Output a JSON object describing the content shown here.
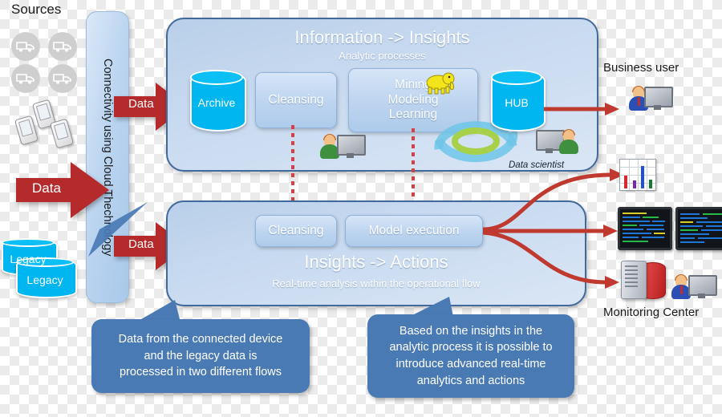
{
  "diagram": {
    "sources": {
      "label": "Sources",
      "device_icons": [
        "truck-icon",
        "truck-icon",
        "truck-icon",
        "truck-icon",
        "mobile-device-icon",
        "mobile-device-icon",
        "mobile-device-icon"
      ],
      "legacy_stores": [
        "Legacy",
        "Legacy"
      ]
    },
    "connectivity": {
      "label": "Connectivity using Cloud Thechnology"
    },
    "data_arrows": [
      {
        "label": "Data",
        "position": "left-main"
      },
      {
        "label": "Data",
        "position": "to-information-panel"
      },
      {
        "label": "Data",
        "position": "to-insights-panel"
      }
    ],
    "panels": [
      {
        "id": "information",
        "title": "Information -> Insights",
        "subtitle": "Analytic processes",
        "stores": [
          {
            "label": "Archive"
          },
          {
            "label": "HUB"
          }
        ],
        "processes": [
          {
            "label": "Cleansing"
          },
          {
            "label": "Mining\nModeling\nLearning",
            "lines": [
              "Mining",
              "Modeling",
              "Learning"
            ],
            "badge": "hadoop-elephant-icon"
          }
        ],
        "actors": [
          {
            "name": "analyst-icon",
            "caption": ""
          },
          {
            "name": "data-scientist-icon",
            "caption": "Data scientist"
          }
        ]
      },
      {
        "id": "insights",
        "title": "Insights -> Actions",
        "subtitle": "Real-time analysis within the operational flow",
        "processes": [
          {
            "label": "Cleansing"
          },
          {
            "label": "Model execution"
          }
        ]
      }
    ],
    "outputs": [
      {
        "id": "business-user",
        "label": "Business user",
        "icon": "business-user-icon"
      },
      {
        "id": "reporting",
        "label": "",
        "icon": "bar-chart-icon"
      },
      {
        "id": "dashboards",
        "label": "",
        "icon": "dual-monitor-terminal-icon"
      },
      {
        "id": "monitoring-center",
        "label": "Monitoring Center",
        "icon": "server-database-operator-icon"
      }
    ],
    "callouts": [
      {
        "id": "left",
        "lines": [
          "Data from the connected device",
          "and the legacy data is",
          "processed in two different flows"
        ],
        "text": "Data from the connected device and the legacy data is processed in two different flows"
      },
      {
        "id": "right",
        "lines": [
          "Based on the insights in the",
          "analytic process it is possible to",
          "introduce advanced real-time",
          "analytics and actions"
        ],
        "text": "Based on the insights in the analytic process it is possible to introduce advanced real-time analytics and actions"
      }
    ],
    "colors": {
      "arrow_red": "#b52a2a",
      "connector_red": "#c0392f",
      "panel_border": "#41699c",
      "cylinder_cyan": "#00b6f0",
      "callout_blue": "#4a7ab4",
      "process_blue": "#bdd4ef"
    }
  }
}
